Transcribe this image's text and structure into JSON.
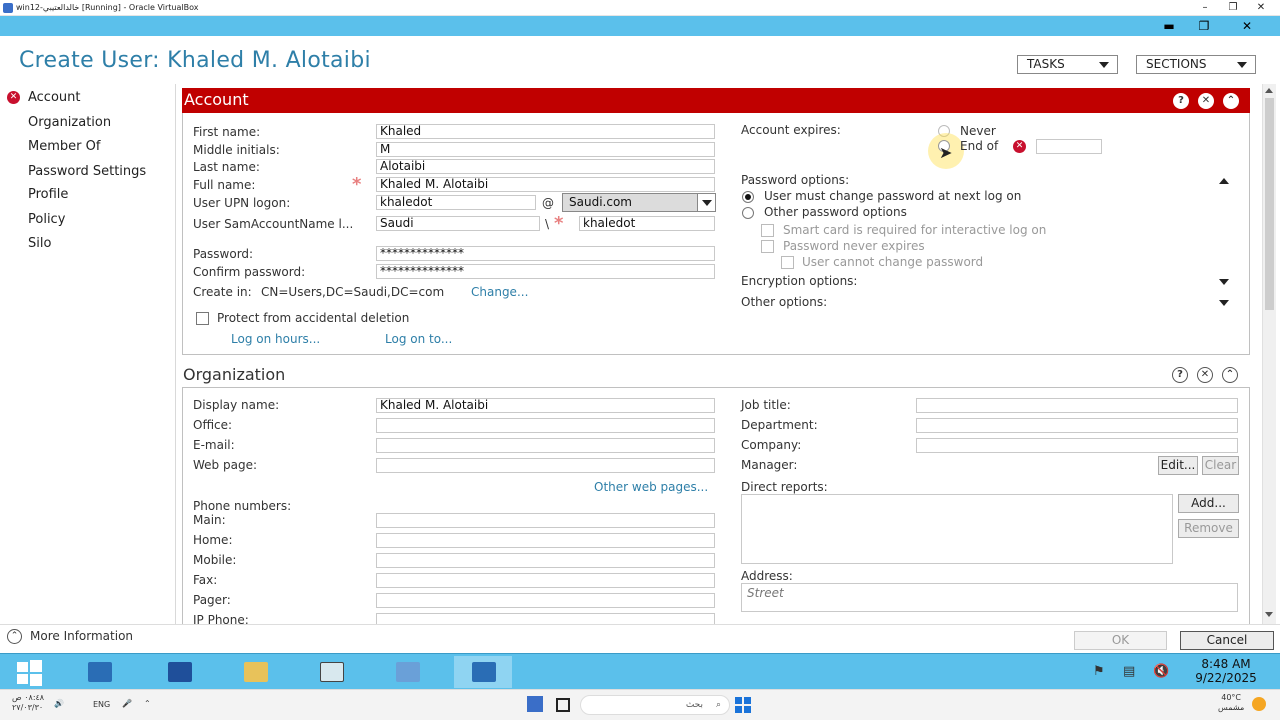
{
  "vbox": {
    "title": "win12-خالدالعتيبي [Running] - Oracle VirtualBox",
    "minimize_icon": "–",
    "maximize_icon": "❐",
    "close_icon": "✕"
  },
  "guest_window": {
    "minimize_icon": "▬",
    "restore_icon": "❐",
    "close_icon": "✕"
  },
  "header": {
    "title": "Create User: Khaled M. Alotaibi",
    "tasks_label": "TASKS",
    "sections_label": "SECTIONS"
  },
  "nav": {
    "items": [
      {
        "label": "Account",
        "error": true
      },
      {
        "label": "Organization"
      },
      {
        "label": "Member Of"
      },
      {
        "label": "Password Settings"
      },
      {
        "label": "Profile"
      },
      {
        "label": "Policy"
      },
      {
        "label": "Silo"
      }
    ]
  },
  "account": {
    "title": "Account",
    "colors": {
      "header_bg": "#c00000",
      "accent": "#2e7fa8",
      "required": "#e88080"
    },
    "fields": {
      "first_name": {
        "label": "First name:",
        "value": "Khaled"
      },
      "middle_initials": {
        "label": "Middle initials:",
        "value": "M"
      },
      "last_name": {
        "label": "Last name:",
        "value": "Alotaibi"
      },
      "full_name": {
        "label": "Full name:",
        "value": "Khaled M. Alotaibi"
      },
      "upn": {
        "label": "User UPN logon:",
        "value": "khaledot",
        "at": "@",
        "domain": "Saudi.com"
      },
      "sam": {
        "label": "User SamAccountName l...",
        "domain": "Saudi",
        "sep": "\\",
        "value": "khaledot"
      },
      "password": {
        "label": "Password:",
        "value": "**************"
      },
      "confirm_password": {
        "label": "Confirm password:",
        "value": "**************"
      }
    },
    "create_in": {
      "label": "Create in:",
      "value": "CN=Users,DC=Saudi,DC=com",
      "change_link": "Change..."
    },
    "protect_label": "Protect from accidental deletion",
    "logon_hours_link": "Log on hours...",
    "logon_to_link": "Log on to...",
    "expires": {
      "label": "Account expires:",
      "never_label": "Never",
      "end_of_label": "End of",
      "end_of_value": ""
    },
    "password_options": {
      "label": "Password options:",
      "must_change_label": "User must change password at next log on",
      "other_label": "Other password options",
      "smart_card_label": "Smart card is required for interactive log on",
      "never_expires_label": "Password never expires",
      "cannot_change_label": "User cannot change password"
    },
    "encryption_label": "Encryption options:",
    "other_options_label": "Other options:"
  },
  "organization": {
    "title": "Organization",
    "display_name": {
      "label": "Display name:",
      "value": "Khaled M. Alotaibi"
    },
    "office_label": "Office:",
    "email_label": "E-mail:",
    "web_page_label": "Web page:",
    "other_web_pages_link": "Other web pages...",
    "phone_numbers_label": "Phone numbers:",
    "phones": [
      "Main:",
      "Home:",
      "Mobile:",
      "Fax:",
      "Pager:",
      "IP Phone:"
    ],
    "job_title_label": "Job title:",
    "department_label": "Department:",
    "company_label": "Company:",
    "manager_label": "Manager:",
    "edit_button": "Edit...",
    "clear_button": "Clear",
    "direct_reports_label": "Direct reports:",
    "add_button": "Add...",
    "remove_button": "Remove",
    "address_label": "Address:",
    "street_placeholder": "Street"
  },
  "footer": {
    "more_info_label": "More Information",
    "ok_label": "OK",
    "cancel_label": "Cancel"
  },
  "taskbar": {
    "time": "8:48 AM",
    "date": "9/22/2025"
  },
  "host_taskbar": {
    "time": "٠٨:٤٨ ص",
    "date": "٢٧/٠٣/٣٠",
    "lang": "ENG",
    "search_placeholder": "بحث",
    "weather_temp": "40°C",
    "weather_text": "مشمس"
  }
}
